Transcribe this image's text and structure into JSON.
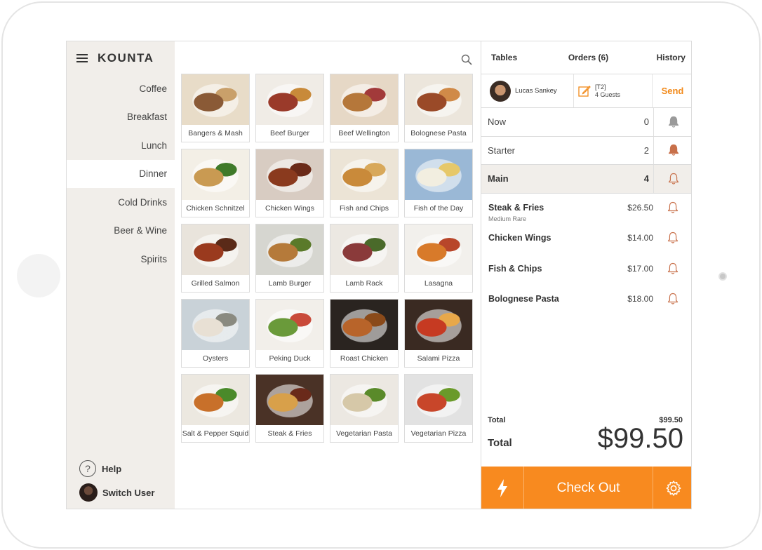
{
  "brand": "KOUNTA",
  "sidebar": {
    "items": [
      {
        "label": "Coffee"
      },
      {
        "label": "Breakfast"
      },
      {
        "label": "Lunch"
      },
      {
        "label": "Dinner",
        "active": true
      },
      {
        "label": "Cold Drinks"
      },
      {
        "label": "Beer & Wine"
      },
      {
        "label": "Spirits"
      }
    ],
    "help_label": "Help",
    "switch_user_label": "Switch User"
  },
  "products": [
    {
      "label": "Bangers & Mash",
      "colors": [
        "#e8dcc8",
        "#8a5a36",
        "#c9a06a"
      ]
    },
    {
      "label": "Beef Burger",
      "colors": [
        "#f0ece6",
        "#9a3a2a",
        "#c88a3a"
      ]
    },
    {
      "label": "Beef Wellington",
      "colors": [
        "#e6d8c6",
        "#b5773a",
        "#a23a3a"
      ]
    },
    {
      "label": "Bolognese Pasta",
      "colors": [
        "#ece6dc",
        "#9a4a28",
        "#d08a48"
      ]
    },
    {
      "label": "Chicken Schnitzel",
      "colors": [
        "#f3efe6",
        "#c99a52",
        "#3f7a2a"
      ]
    },
    {
      "label": "Chicken Wings",
      "colors": [
        "#d8ccc2",
        "#8a3a1e",
        "#6a2a18"
      ]
    },
    {
      "label": "Fish and Chips",
      "colors": [
        "#ece4d6",
        "#c98a3a",
        "#d8a85a"
      ]
    },
    {
      "label": "Fish of the Day",
      "colors": [
        "#9ab8d6",
        "#f2eee0",
        "#e6c86a"
      ]
    },
    {
      "label": "Grilled Salmon",
      "colors": [
        "#e9e4dc",
        "#9a3a1e",
        "#5a2a18"
      ]
    },
    {
      "label": "Lamb Burger",
      "colors": [
        "#d6d6d0",
        "#b57a3a",
        "#5a7a2a"
      ]
    },
    {
      "label": "Lamb Rack",
      "colors": [
        "#ece8e2",
        "#8a3a3a",
        "#4a6a2a"
      ]
    },
    {
      "label": "Lasagna",
      "colors": [
        "#f2f0ec",
        "#d87a2a",
        "#b8462a"
      ]
    },
    {
      "label": "Oysters",
      "colors": [
        "#c9d2d8",
        "#e8e0d4",
        "#8a8a80"
      ]
    },
    {
      "label": "Peking Duck",
      "colors": [
        "#f2efea",
        "#6a9a3a",
        "#c94a3a"
      ]
    },
    {
      "label": "Roast Chicken",
      "colors": [
        "#2a2420",
        "#b8642a",
        "#8a4a1a"
      ]
    },
    {
      "label": "Salami Pizza",
      "colors": [
        "#3a2a22",
        "#c63a22",
        "#e8a84a"
      ]
    },
    {
      "label": "Salt & Pepper Squid",
      "colors": [
        "#ece8e0",
        "#c8702a",
        "#4a8a2a"
      ]
    },
    {
      "label": "Steak & Fries",
      "colors": [
        "#4a3226",
        "#d8a04a",
        "#6a2a1a"
      ]
    },
    {
      "label": "Vegetarian Pasta",
      "colors": [
        "#ece8e2",
        "#d6c8a8",
        "#5a8a2a"
      ]
    },
    {
      "label": "Vegetarian Pizza",
      "colors": [
        "#e2e2e2",
        "#c8462a",
        "#6a9a2a"
      ]
    }
  ],
  "panel": {
    "tabs": [
      "Tables",
      "Orders (6)",
      "History"
    ],
    "customer": "Lucas Sankey",
    "table": "[T2]",
    "guests": "4 Guests",
    "send_label": "Send",
    "courses": [
      {
        "name": "Now",
        "count": "0",
        "bell": "grey"
      },
      {
        "name": "Starter",
        "count": "2",
        "bell": "filled"
      },
      {
        "name": "Main",
        "count": "4",
        "bell": "outline",
        "active": true
      }
    ],
    "items": [
      {
        "name": "Steak & Fries",
        "modifier": "Medium Rare",
        "price": "$26.50"
      },
      {
        "name": "Chicken Wings",
        "modifier": "",
        "price": "$14.00"
      },
      {
        "name": "Fish & Chips",
        "modifier": "",
        "price": "$17.00"
      },
      {
        "name": "Bolognese Pasta",
        "modifier": "",
        "price": "$18.00"
      }
    ],
    "subtotal_label": "Total",
    "subtotal_value": "$99.50",
    "total_label": "Total",
    "total_value": "$99.50",
    "checkout_label": "Check Out"
  },
  "colors": {
    "accent": "#f88a1f",
    "sidebar_bg": "#f1eeea",
    "bell_active": "#c8704a"
  }
}
